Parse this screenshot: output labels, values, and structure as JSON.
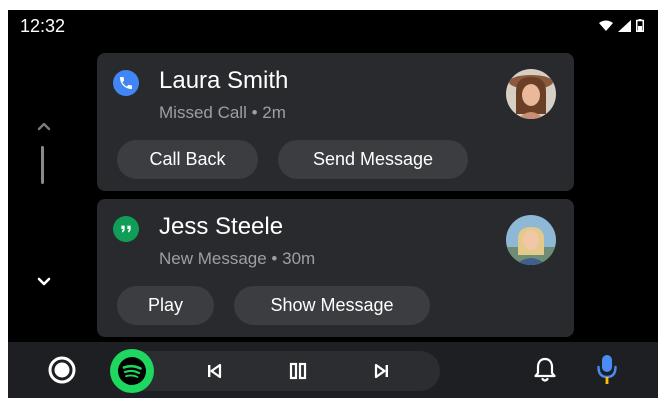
{
  "status_bar": {
    "time": "12:32",
    "icons": [
      "wifi-icon",
      "cell-signal-icon",
      "battery-icon"
    ]
  },
  "side_rail": {
    "icons": [
      "chevron-up-icon",
      "chevron-down-icon"
    ]
  },
  "notifications": [
    {
      "app_icon": "phone-icon",
      "title": "Laura Smith",
      "subtitle": "Missed Call • 2m",
      "actions": [
        "Call Back",
        "Send Message"
      ]
    },
    {
      "app_icon": "hangouts-icon",
      "title": "Jess Steele",
      "subtitle": "New Message • 30m",
      "actions": [
        "Play",
        "Show Message"
      ]
    }
  ],
  "nav_bar": {
    "icons": [
      "home-icon",
      "spotify-icon",
      "skip-previous-icon",
      "pause-icon",
      "skip-next-icon",
      "bell-icon",
      "mic-icon"
    ]
  },
  "colors": {
    "background": "#000000",
    "card": "#292a2d",
    "chip": "#3c3d41",
    "nav_bar": "#1e1f22",
    "phone_badge": "#4285f4",
    "hangouts_badge": "#0f9d58",
    "spotify": "#1ed760",
    "mic_blue": "#4a8cf5",
    "mic_yellow": "#fbbc04"
  }
}
